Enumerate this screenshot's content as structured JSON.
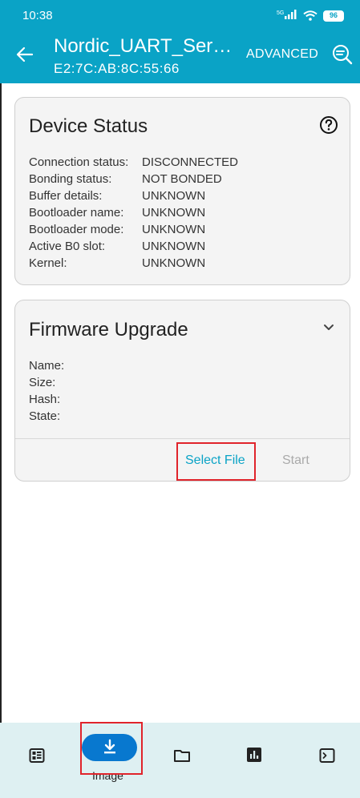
{
  "status_bar": {
    "time": "10:38",
    "signal": "5G",
    "battery": "96"
  },
  "app_bar": {
    "title": "Nordic_UART_Ser…",
    "subtitle": "E2:7C:AB:8C:55:66",
    "advanced_label": "ADVANCED",
    "back_icon": "arrow-left-icon",
    "scan_icon": "search-scan-icon",
    "color": "#0aa3c6"
  },
  "device_status": {
    "title": "Device Status",
    "help_icon": "help-circle-icon",
    "rows": [
      {
        "label": "Connection status:",
        "value": "DISCONNECTED"
      },
      {
        "label": "Bonding status:",
        "value": "NOT BONDED"
      },
      {
        "label": "Buffer details:",
        "value": "UNKNOWN"
      },
      {
        "label": "Bootloader name:",
        "value": "UNKNOWN"
      },
      {
        "label": "Bootloader mode:",
        "value": "UNKNOWN"
      },
      {
        "label": "Active B0 slot:",
        "value": "UNKNOWN"
      },
      {
        "label": "Kernel:",
        "value": "UNKNOWN"
      }
    ]
  },
  "firmware_upgrade": {
    "title": "Firmware Upgrade",
    "fields": [
      {
        "label": "Name:",
        "value": ""
      },
      {
        "label": "Size:",
        "value": ""
      },
      {
        "label": "Hash:",
        "value": ""
      },
      {
        "label": "State:",
        "value": ""
      }
    ],
    "select_file_label": "Select File",
    "start_label": "Start"
  },
  "bottom_nav": {
    "items": [
      {
        "icon": "dashboard-icon",
        "label": ""
      },
      {
        "icon": "download-icon",
        "label": "Image",
        "selected": true
      },
      {
        "icon": "folder-icon",
        "label": ""
      },
      {
        "icon": "stats-icon",
        "label": ""
      },
      {
        "icon": "terminal-icon",
        "label": ""
      }
    ],
    "accent": "#0878cf",
    "background": "#def0f2"
  }
}
